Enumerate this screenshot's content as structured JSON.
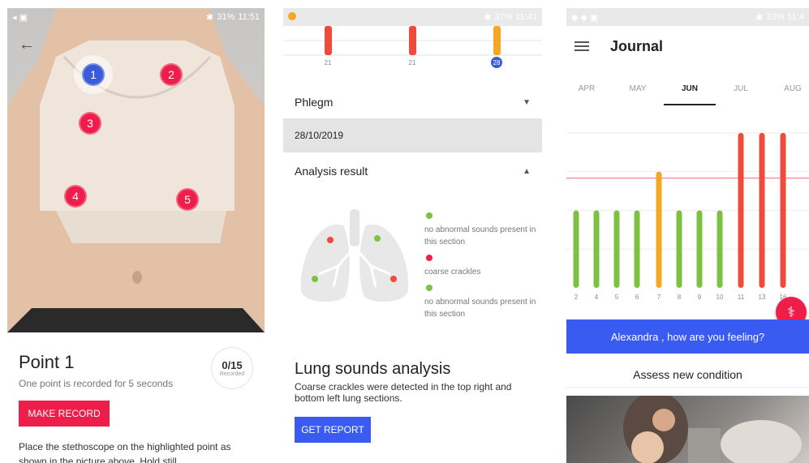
{
  "screen1": {
    "status": {
      "left_icons": "◂ ▣",
      "battery": "31%",
      "time": "11:51"
    },
    "points": [
      "1",
      "2",
      "3",
      "4",
      "5"
    ],
    "active_point": "1",
    "title": "Point 1",
    "subtitle": "One point is recorded for 5 seconds",
    "counter": {
      "value": "0/15",
      "label": "Recorded"
    },
    "record_button": "MAKE RECORD",
    "instruction": "Place the stethoscope on the highlighted point as shown in the picture above. Hold still",
    "colors": {
      "accent_red": "#ef1d4a",
      "active_blue": "#3a5bd9"
    }
  },
  "screen2": {
    "status": {
      "battery": "37%",
      "time": "11:41"
    },
    "top_chart": {
      "ticks": [
        "21",
        "21",
        "28"
      ],
      "selected_tick": "28"
    },
    "phlegm_label": "Phlegm",
    "date": "28/10/2019",
    "analysis_label": "Analysis result",
    "legend": [
      {
        "color": "#7cc142",
        "text": "no abnormal sounds present in this section"
      },
      {
        "color": "#ef1d4a",
        "text": "coarse crackles"
      },
      {
        "color": "#7cc142",
        "text": "no abnormal sounds present in this section"
      }
    ],
    "lsa_title": "Lung sounds analysis",
    "lsa_desc": "Coarse crackles were detected in the top right and bottom left lung sections.",
    "report_button": "GET REPORT"
  },
  "screen3": {
    "status": {
      "battery": "33%",
      "time": "11:4"
    },
    "title": "Journal",
    "months": [
      "APR",
      "MAY",
      "JUN",
      "JUL",
      "AUG"
    ],
    "selected_month": "JUN",
    "greeting": "Alexandra , how are you feeling?",
    "assess": "Assess new condition",
    "chart_data": {
      "type": "bar",
      "categories": [
        "2",
        "4",
        "5",
        "6",
        "7",
        "8",
        "9",
        "10",
        "11",
        "13",
        "16"
      ],
      "values": [
        2,
        2,
        2,
        2,
        3,
        2,
        2,
        2,
        4,
        4,
        4
      ],
      "bar_colors": [
        "#7cc142",
        "#7cc142",
        "#7cc142",
        "#7cc142",
        "#f5a623",
        "#7cc142",
        "#7cc142",
        "#7cc142",
        "#ef4a3a",
        "#ef4a3a",
        "#ef4a3a"
      ],
      "threshold": 3,
      "ylim": [
        0,
        4.5
      ],
      "grid": true
    }
  }
}
